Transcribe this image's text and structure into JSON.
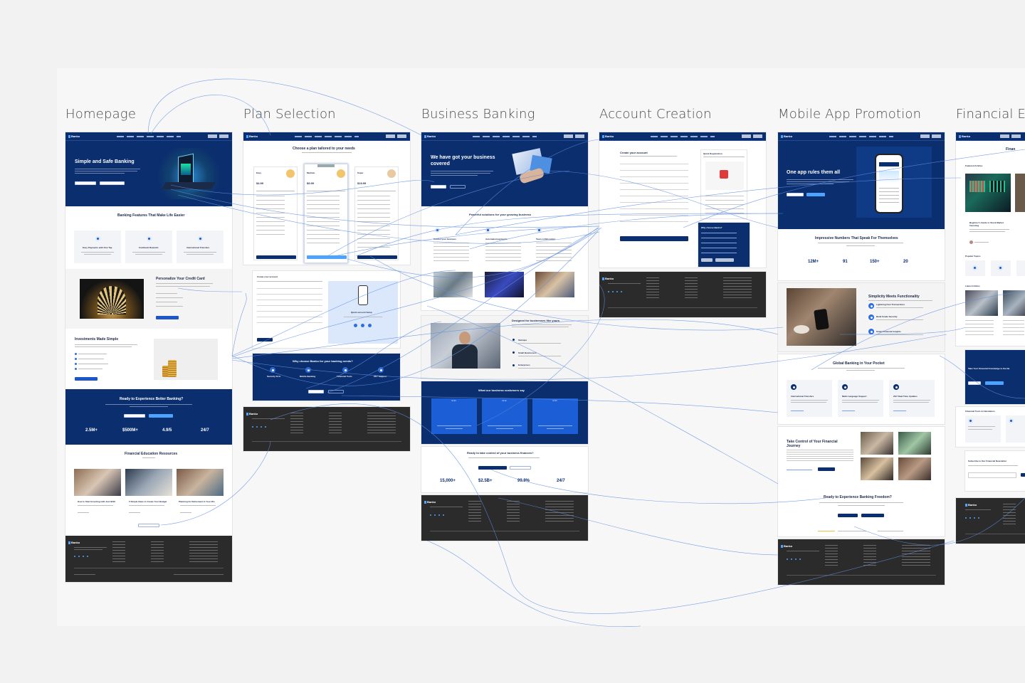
{
  "columns": [
    "Homepage",
    "Plan Selection",
    "Business Banking",
    "Account Creation",
    "Mobile App Promotion",
    "Financial Ed"
  ],
  "brand": "Banko",
  "homepage": {
    "hero_title": "Simple and Safe Banking",
    "features_title": "Banking Features That Make Life Easier",
    "features": [
      "Easy Payments with One Tap",
      "Cashback Rewards",
      "International Transfers"
    ],
    "credit_title": "Personalize Your Credit Card",
    "invest_title": "Investments Made Simple",
    "cta_title": "Ready to Experience Better Banking?",
    "stats": [
      "2.5M+",
      "$500M+",
      "4.9/5",
      "24/7"
    ],
    "edu_title": "Financial Education Resources",
    "articles": [
      "How to Start Investing with Just $100",
      "5 Simple Ideas to Create Your Budget",
      "Planning for Retirement in Your 20s"
    ]
  },
  "plan": {
    "title": "Choose a plan tailored to your needs",
    "plans": [
      {
        "name": "Easy",
        "price": "$4.99"
      },
      {
        "name": "Medium",
        "price": "$9.99"
      },
      {
        "name": "Super",
        "price": "$19.99"
      }
    ],
    "create_title": "Create your account",
    "setup_label": "Quick account Setup",
    "why_title": "Why choose Banko for your banking needs?",
    "why_items": [
      "Security First",
      "Mobile Banking",
      "Financial Tools",
      "24/7 Support"
    ]
  },
  "business": {
    "hero_title": "We have got your business covered",
    "solutions_title": "Powerful solutions for your growing business",
    "solutions": [
      "Control your business",
      "Automated payments",
      "Team collaboration"
    ],
    "designed_title": "Designed for businesses like yours",
    "designed_items": [
      "Startups",
      "Small Businesses",
      "Enterprises"
    ],
    "testimonials_title": "What our business customers say",
    "cta_title": "Ready to take control of your business finances?",
    "stats": [
      "15,000+",
      "$2.5B+",
      "99.9%",
      "24/7"
    ]
  },
  "account": {
    "title": "Create your account",
    "quick_title": "Quick Registration",
    "why_title": "Why choose Banko?"
  },
  "mobile": {
    "hero_title": "One app rules them all",
    "numbers_title": "Impressive Numbers That Speak For Themselves",
    "stats": [
      "12M+",
      "91",
      "150+",
      "20"
    ],
    "func_title": "Simplicity Meets Functionality",
    "func_items": [
      "Lightning Fast Transactions",
      "Bank Grade Security",
      "Smart Financial Insights"
    ],
    "global_title": "Global Banking in Your Pocket",
    "global_items": [
      "International Transfers",
      "Multi-Language Support",
      "24/7 Real-Time Updates"
    ],
    "control_title": "Take Control of Your Financial Journey",
    "cta_title": "Ready to Experience Banking Freedom?"
  },
  "fined": {
    "hero_title": "Finan",
    "featured": "Featured Articles",
    "popular": "Popular Topics",
    "latest": "Latest Articles",
    "take": "Take Your Financial Knowledge to the Ne",
    "tools": "Financial Tools & Calculators",
    "subscribe": "Subscribe to Our Financial Newsletter",
    "guide": "Beginner's Guide to Stock Market Investing"
  },
  "colors": {
    "navy": "#0b2e6e",
    "accent": "#1d56c9",
    "footer": "#2b2b2b",
    "canvas": "#f2f2f2",
    "link": "#5f8fe0"
  }
}
